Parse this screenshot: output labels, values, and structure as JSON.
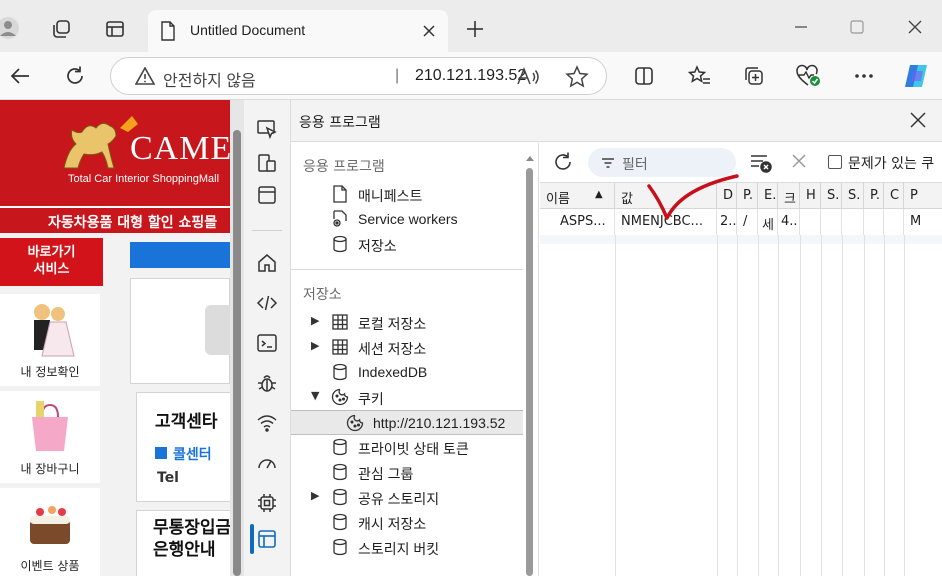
{
  "browser": {
    "tab_title": "Untitled Document",
    "address": {
      "security_warning": "안전하지 않음",
      "separator": "|",
      "host": "210.121.193.52"
    }
  },
  "website": {
    "logo_text": "CAMEL",
    "tagline": "Total Car Interior ShoppingMall",
    "banner_strip": "자동차용품 대형 할인 쇼핑몰",
    "shortcut_label": "바로가기\n서비스",
    "side_items": [
      {
        "label": "내 정보확인"
      },
      {
        "label": "내 장바구니"
      },
      {
        "label": "이벤트 상품"
      }
    ],
    "boxes": [
      {
        "title": "고객센타",
        "sub": "콜센터",
        "sub2": "Tel"
      },
      {
        "title": "무통장입금\n은행안내"
      }
    ]
  },
  "devtools": {
    "panel_title": "응용 프로그램",
    "tree": {
      "section_app": "응용 프로그램",
      "app_items": [
        "매니페스트",
        "Service workers",
        "저장소"
      ],
      "section_storage": "저장소",
      "storage_items": [
        {
          "label": "로컬 저장소",
          "expandable": true
        },
        {
          "label": "세션 저장소",
          "expandable": true
        },
        {
          "label": "IndexedDB",
          "expandable": false
        },
        {
          "label": "쿠키",
          "expandable": true,
          "expanded": true
        }
      ],
      "cookie_child": "http://210.121.193.52",
      "more_items": [
        {
          "label": "프라이빗 상태 토큰",
          "expandable": false
        },
        {
          "label": "관심 그룹",
          "expandable": false
        },
        {
          "label": "공유 스토리지",
          "expandable": true
        },
        {
          "label": "캐시 저장소",
          "expandable": false
        },
        {
          "label": "스토리지 버킷",
          "expandable": false
        }
      ]
    },
    "toolbar": {
      "filter_placeholder": "필터",
      "issues_only_label": "문제가 있는 쿠"
    },
    "grid": {
      "headers": [
        "이름",
        "값",
        "D",
        "P.",
        "E.",
        "크",
        "H",
        "S.",
        "S.",
        "P.",
        "C",
        "P"
      ],
      "sort_indicator": "▲",
      "row": [
        "ASPS...",
        "NMENJCBC...",
        "2..",
        "/",
        "세",
        "4..",
        "",
        "",
        "",
        "",
        "",
        "M"
      ]
    }
  },
  "colors": {
    "accent": "#0f6cbd",
    "site_red": "#c8161d",
    "site_blue": "#1a73d9",
    "annotation_red": "#c8101c"
  }
}
